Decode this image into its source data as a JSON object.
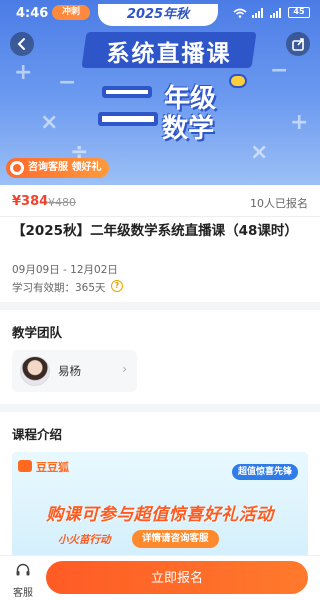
{
  "status_bar": {
    "time": "4:46",
    "badge": "冲刺",
    "battery": "45"
  },
  "hero": {
    "season_tag": "2025年秋",
    "title": "系统直播课",
    "grade": "年级",
    "subject": "数学",
    "consult_label": "咨询客服 领好礼"
  },
  "course": {
    "price": "¥384",
    "original_price": "¥480",
    "enrolled": "10人已报名",
    "title": "【2025秋】二年级数学系统直播课（48课时）",
    "date_range": "09月09日 - 12月02日",
    "validity": "学习有效期：365天",
    "help_icon": "?"
  },
  "teachers": {
    "section_title": "教学团队",
    "items": [
      {
        "name": "易杨"
      }
    ]
  },
  "intro": {
    "section_title": "课程介绍",
    "brand": "豆豆狐",
    "tag": "超值惊喜先锋",
    "headline": "购课可参与超值惊喜好礼活动",
    "sub_label": "小火苗行动",
    "cta": "详情请咨询客服"
  },
  "bottom_bar": {
    "service_label": "客服",
    "enroll_label": "立即报名"
  },
  "colors": {
    "accent": "#ff5b25",
    "price": "#f0432d",
    "hero_blue": "#2f56c8"
  }
}
